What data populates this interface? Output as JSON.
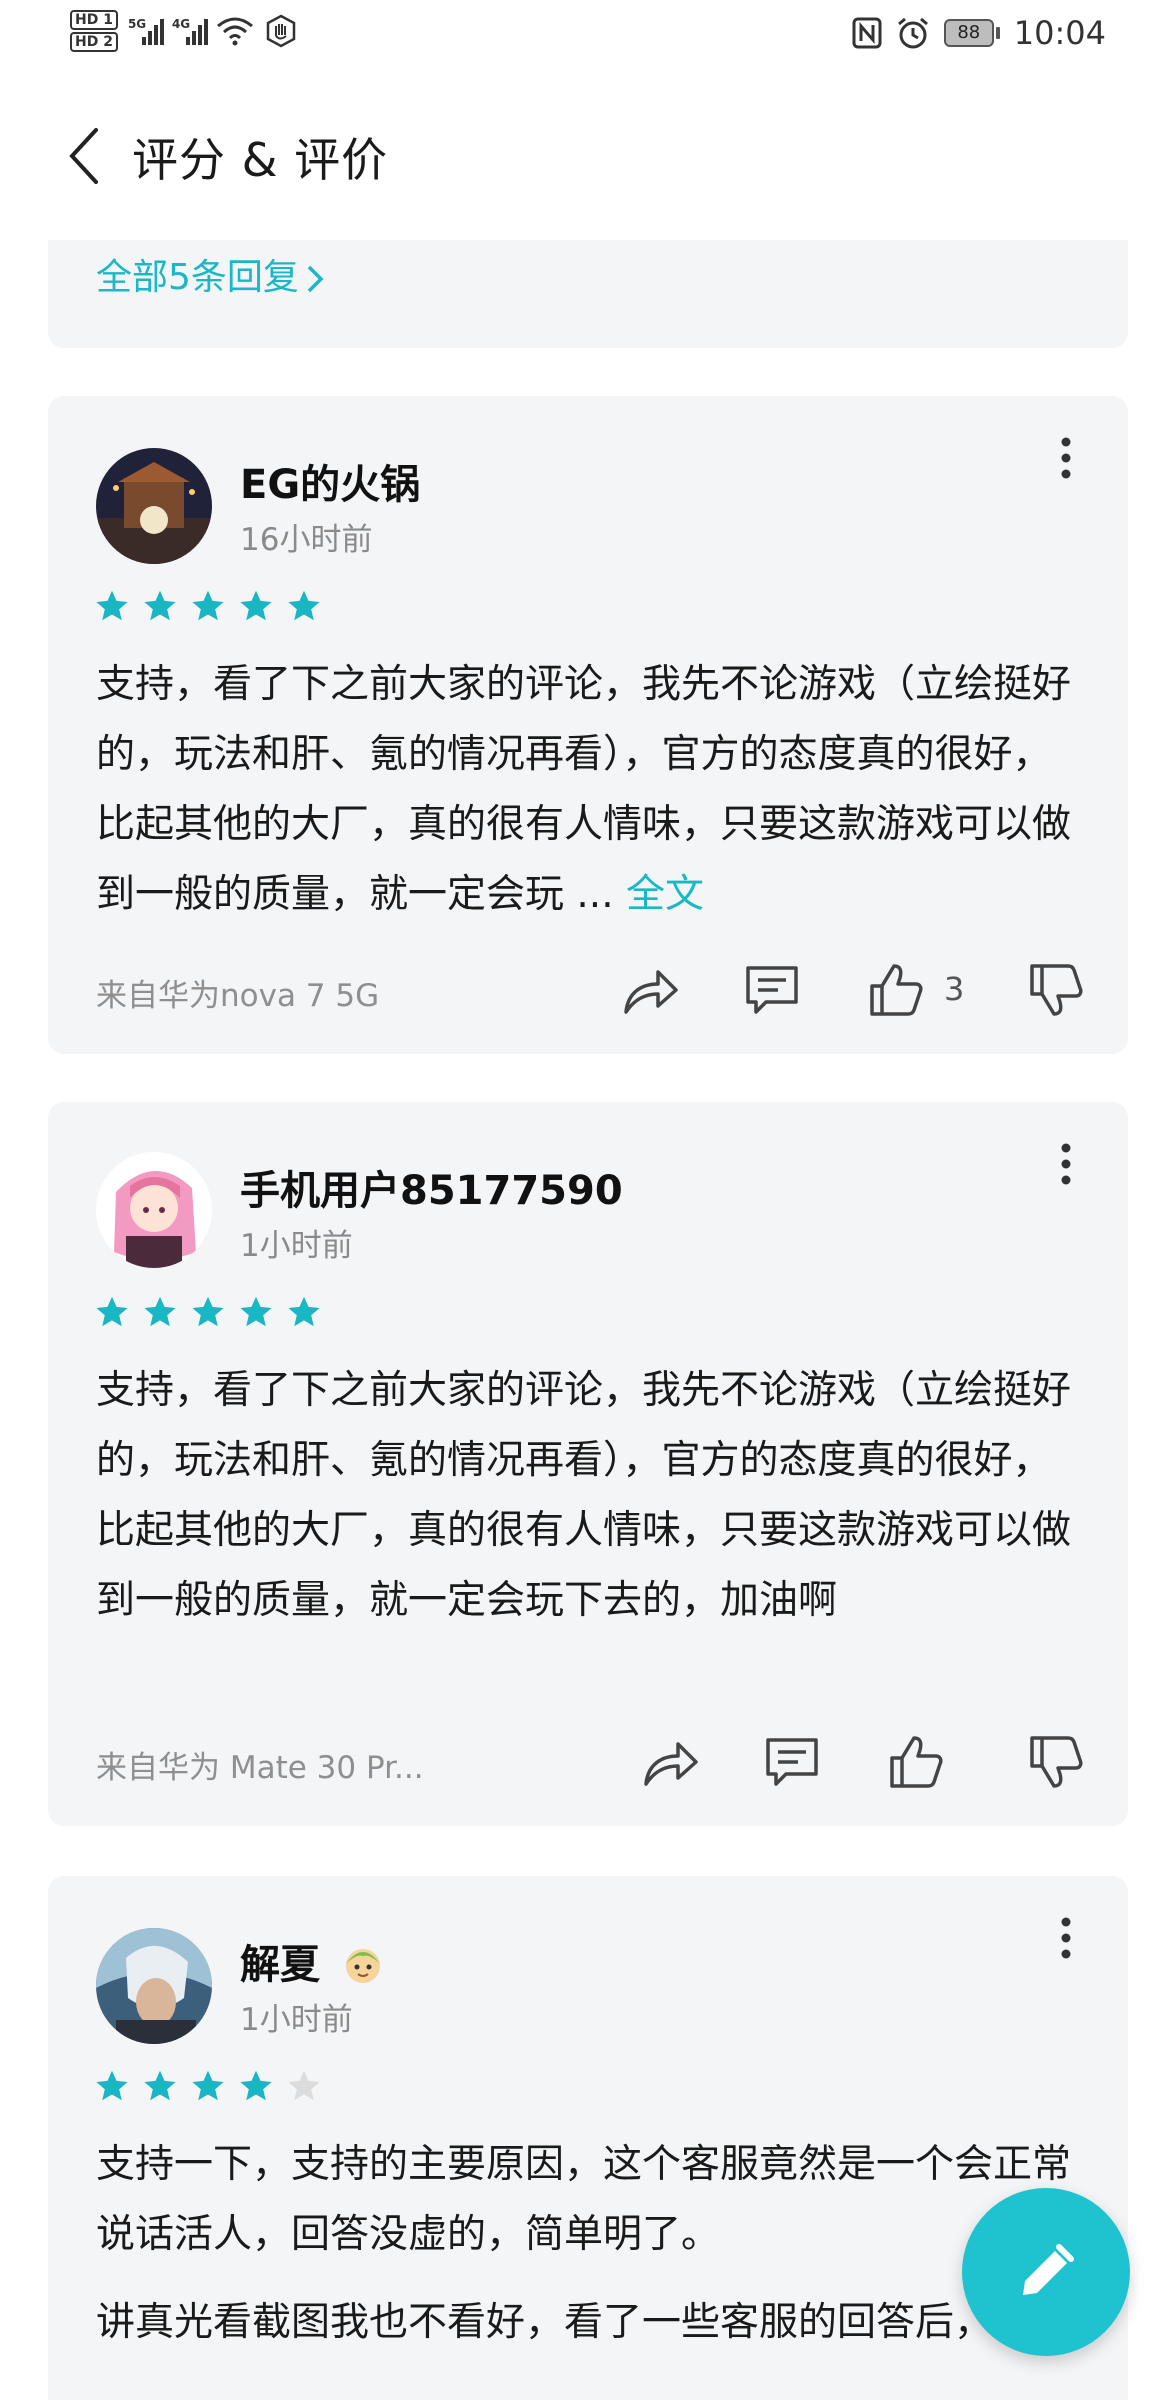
{
  "status_bar": {
    "hd1": "HD 1",
    "hd2": "HD 2",
    "net1": "5G",
    "net2": "4G",
    "battery": "88",
    "time": "10:04"
  },
  "header": {
    "title": "评分 & 评价"
  },
  "prev_card": {
    "replies_link": "全部5条回复"
  },
  "reviews": [
    {
      "user": "EG的火锅",
      "time": "16小时前",
      "rating": 5,
      "text": "支持，看了下之前大家的评论，我先不论游戏（立绘挺好的，玩法和肝、氪的情况再看），官方的态度真的很好，比起其他的大厂，真的很有人情味，只要这款游戏可以做到一般的质量，就一定会玩",
      "ellipsis": " ... ",
      "full_text_link": "全文",
      "device": "来自华为nova 7 5G",
      "likes": "3"
    },
    {
      "user": "手机用户85177590",
      "time": "1小时前",
      "rating": 5,
      "text": "支持，看了下之前大家的评论，我先不论游戏（立绘挺好的，玩法和肝、氪的情况再看），官方的态度真的很好，比起其他的大厂，真的很有人情味，只要这款游戏可以做到一般的质量，就一定会玩下去的，加油啊",
      "device": "来自华为 Mate 30 Pr..."
    },
    {
      "user": "解夏",
      "time": "1小时前",
      "rating": 4,
      "text": "支持一下，支持的主要原因，这个客服竟然是一个会正常说话活人，回答没虚的，简单明了。",
      "text2": "讲真光看截图我也不看好，看了一些客服的回答后，试试"
    }
  ],
  "colors": {
    "accent": "#1ab8c6",
    "star_on": "#19b6c4",
    "star_off": "#dcdcdc",
    "card_bg": "#f4f5f7"
  },
  "icons": {
    "back": "chevron-left-icon",
    "more": "more-vertical-icon",
    "share": "share-icon",
    "comment": "comment-icon",
    "like": "thumb-up-icon",
    "dislike": "thumb-down-icon",
    "write": "pencil-icon"
  }
}
